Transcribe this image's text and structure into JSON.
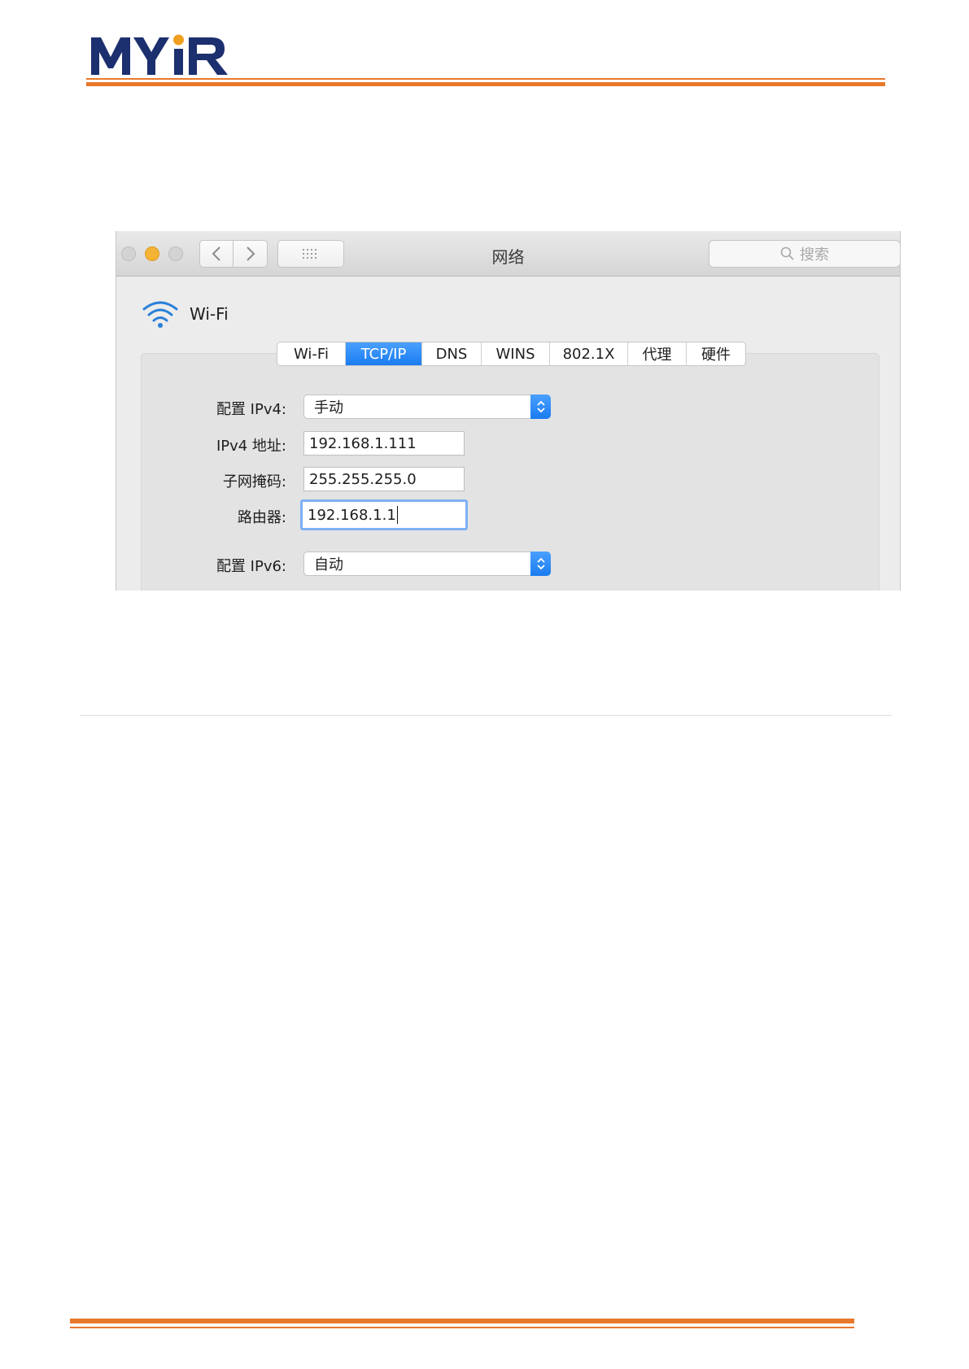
{
  "document": {
    "logo_text": "MYIR",
    "brand_color": "#1c2f6e",
    "accent_color": "#e8782a"
  },
  "window": {
    "title": "网络",
    "search_placeholder": "搜索",
    "icons": {
      "back": "chevron-left-icon",
      "forward": "chevron-right-icon",
      "show_all": "grid-icon",
      "search": "magnifier-icon",
      "service": "wifi-icon"
    }
  },
  "service": {
    "name": "Wi-Fi"
  },
  "tabs": [
    {
      "label": "Wi-Fi",
      "active": false
    },
    {
      "label": "TCP/IP",
      "active": true
    },
    {
      "label": "DNS",
      "active": false
    },
    {
      "label": "WINS",
      "active": false
    },
    {
      "label": "802.1X",
      "active": false
    },
    {
      "label": "代理",
      "active": false
    },
    {
      "label": "硬件",
      "active": false
    }
  ],
  "tcpip": {
    "configure_ipv4": {
      "label": "配置 IPv4:",
      "value": "手动"
    },
    "ipv4_address": {
      "label": "IPv4 地址:",
      "value": "192.168.1.111"
    },
    "subnet_mask": {
      "label": "子网掩码:",
      "value": "255.255.255.0"
    },
    "router": {
      "label": "路由器:",
      "value": "192.168.1.1"
    },
    "configure_ipv6": {
      "label": "配置 IPv6:",
      "value": "自动"
    }
  }
}
